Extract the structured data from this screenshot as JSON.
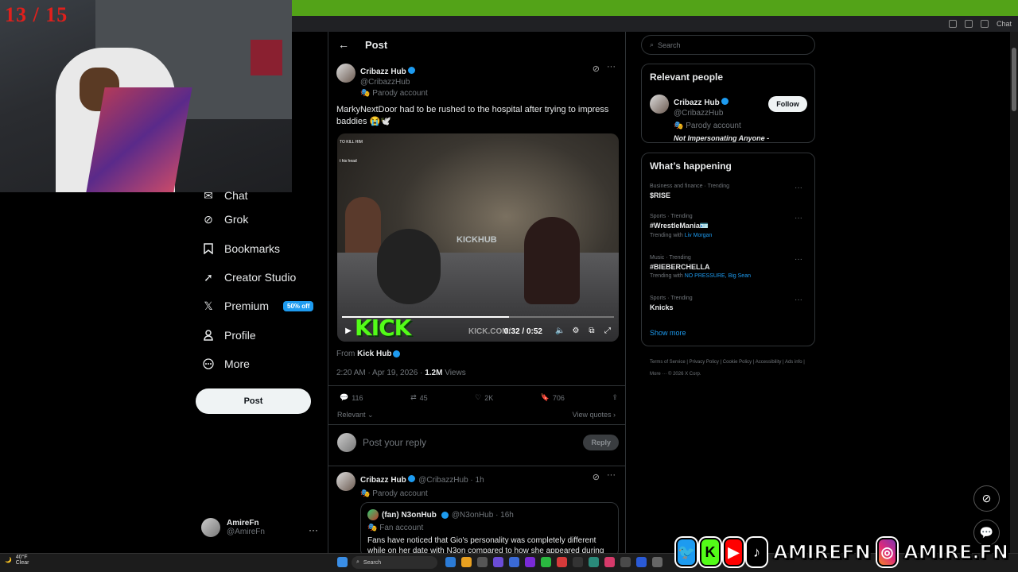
{
  "stream": {
    "counter": "13 / 15"
  },
  "browser": {
    "tab_chat": "Chat"
  },
  "nav": {
    "items": [
      {
        "label": "Chat",
        "icon": "chat-icon"
      },
      {
        "label": "Grok",
        "icon": "grok-icon"
      },
      {
        "label": "Bookmarks",
        "icon": "bookmark-icon"
      },
      {
        "label": "Creator Studio",
        "icon": "rocket-icon"
      },
      {
        "label": "Premium",
        "icon": "x-logo-icon",
        "badge": "50% off"
      },
      {
        "label": "Profile",
        "icon": "person-icon"
      },
      {
        "label": "More",
        "icon": "more-circle-icon"
      }
    ],
    "post_button": "Post",
    "account": {
      "name": "AmireFn",
      "handle": "@AmireFn"
    }
  },
  "main": {
    "header_title": "Post",
    "tweet": {
      "name": "Cribazz Hub",
      "handle": "@CribazzHub",
      "parody": "Parody account",
      "text": "MarkyNextDoor had to be rushed to the hospital after  trying to impress baddies 😭🕊️",
      "video": {
        "watermark": "KICKHUB",
        "brand": "KICK",
        "url": "KICK.COM/",
        "time": "0:32 / 0:52",
        "progress": 0.615,
        "overlay_line1": "TO KILL HIM",
        "overlay_line2": "t his head"
      },
      "from_label": "From",
      "from_source": "Kick Hub",
      "timestamp": "2:20 AM · Apr 19, 2026 · ",
      "views_count": "1.2M",
      "views_label": " Views",
      "replies": "116",
      "reposts": "45",
      "likes": "2K",
      "bookmarks": "706",
      "relevant": "Relevant",
      "view_quotes": "View quotes"
    },
    "reply": {
      "placeholder": "Post your reply",
      "button": "Reply"
    },
    "reply_tweet": {
      "name": "Cribazz Hub",
      "handle": "@CribazzHub · 1h",
      "parody": "Parody account",
      "quote": {
        "name": "(fan) N3onHub",
        "handle": "@N3onHub · 16h",
        "label": "Fan account",
        "text": "Fans have noticed that Gio's personality was completely different while on her date with N3on compared to how she appeared during her time"
      }
    }
  },
  "right": {
    "search_placeholder": "Search",
    "relevant_title": "Relevant people",
    "person": {
      "name": "Cribazz Hub",
      "handle": "@CribazzHub",
      "parody": "Parody account",
      "bio": "Not Impersonating Anyone -",
      "follow": "Follow"
    },
    "happening_title": "What’s happening",
    "trends": [
      {
        "cat": "Business and finance · Trending",
        "name": "$RISE",
        "with_prefix": "",
        "with": ""
      },
      {
        "cat": "Sports · Trending",
        "name": "#WrestleMania🪪",
        "with_prefix": "Trending with ",
        "with": "Liv Morgan"
      },
      {
        "cat": "Music · Trending",
        "name": "#BIEBERCHELLA",
        "with_prefix": "Trending with ",
        "with": "NO PRESSURE, Big Sean"
      },
      {
        "cat": "Sports · Trending",
        "name": "Knicks",
        "with_prefix": "",
        "with": ""
      }
    ],
    "show_more": "Show more",
    "footer": "Terms of Service  |  Privacy Policy  |  Cookie Policy  |  Accessibility  |  Ads info  |  More ···  © 2026 X Corp."
  },
  "taskbar": {
    "temp": "40°F",
    "weather": "Clear",
    "search": "Search"
  },
  "overlay": {
    "handle1": "AMIREFN",
    "handle2": "AMIRE.FN"
  }
}
